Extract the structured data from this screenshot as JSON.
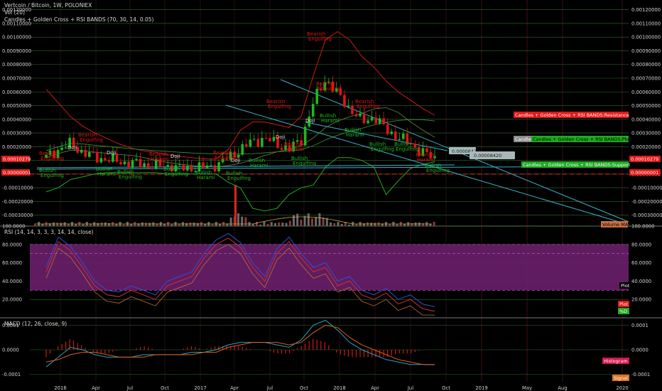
{
  "header": {
    "symbol": "Vertcoin / Bitcoin, 1W, POLONIEX",
    "volume": "Vol (20)",
    "indicator": "Candles + Golden Cross + RSI BANDS (70, 30, 14, 0.05)"
  },
  "rsi_panel": {
    "title": "RSI (14, 14, 3, 3, 3, 14, 14, close)"
  },
  "macd_panel": {
    "title": "MACD (12, 26, close, 9)"
  },
  "colors": {
    "background": "#000000",
    "grid": "#2f6b2f",
    "up": "#1fb81f",
    "down": "#e01515",
    "rsi_band": "#6a1f6a",
    "rsi_line": "#cc3030",
    "macd_line": "#26a3b8",
    "signal_line": "#e05a1a",
    "trendline": "#3ab0c8"
  },
  "chart_data": [
    {
      "type": "candlestick",
      "title": "Vertcoin / Bitcoin, 1W, POLONIEX",
      "x_ticks": [
        "2016",
        "Apr",
        "Jul",
        "Oct",
        "2017",
        "Apr",
        "Jul",
        "Oct",
        "2018",
        "Apr",
        "Jul",
        "Oct",
        "2019",
        "May",
        "Aug",
        "2020"
      ],
      "y_ticks_right": [
        "0.00120000",
        "0.00110000",
        "0.00100000",
        "0.00090000",
        "0.00080000",
        "0.00070000",
        "0.00060000",
        "0.00050000",
        "0.00040000",
        "0.00030000",
        "0.00020000",
        "0.00010000",
        "0.00000000",
        "-0.00010000",
        "-0.00020000",
        "-0.00030000"
      ],
      "y_ticks_left": [
        "0.00120000",
        "0.00110000",
        "0.00100000",
        "0.00090000",
        "0.00080000",
        "0.00070000",
        "0.00060000",
        "0.00050000",
        "0.00040000",
        "0.00030000",
        "0.00020000",
        "-0.00010000",
        "-0.00020000",
        "-0.00030000"
      ],
      "ylim": [
        -0.00038,
        0.00124
      ],
      "price_badges": [
        "0.00010279",
        "0.00000001"
      ],
      "price_label": "0.00010279",
      "zero_label": "0.00000001",
      "weeks": [
        "2016-01",
        "2016-02",
        "2016-03",
        "2016-04",
        "2016-05",
        "2016-06",
        "2016-07",
        "2016-08",
        "2016-09",
        "2016-10",
        "2016-11",
        "2016-12",
        "2017-01",
        "2017-02",
        "2017-03",
        "2017-04",
        "2017-05",
        "2017-06",
        "2017-07",
        "2017-08",
        "2017-09",
        "2017-10",
        "2017-11",
        "2017-12",
        "2018-01",
        "2018-02",
        "2018-03",
        "2018-04",
        "2018-05",
        "2018-06",
        "2018-07",
        "2018-08",
        "2018-09"
      ],
      "close": [
        0.00012,
        0.00018,
        0.00022,
        0.00016,
        0.00012,
        0.00011,
        9e-05,
        8e-05,
        7e-05,
        6e-05,
        6e-05,
        4e-05,
        4e-05,
        5e-05,
        6e-05,
        0.00012,
        0.00018,
        0.00024,
        0.00026,
        0.00022,
        0.00018,
        0.00025,
        0.00052,
        0.0007,
        0.00058,
        0.00048,
        0.00038,
        0.00042,
        0.00032,
        0.00027,
        0.00022,
        0.00016,
        0.00011
      ],
      "resistance": [
        0.00062,
        0.00052,
        0.00042,
        0.00035,
        0.0003,
        0.00026,
        0.00022,
        0.00019,
        0.00017,
        0.00016,
        0.00014,
        0.00013,
        0.00012,
        0.00011,
        0.00011,
        0.00018,
        0.00032,
        0.00038,
        0.00038,
        0.00036,
        0.00034,
        0.00042,
        0.00072,
        0.00098,
        0.00104,
        0.00098,
        0.00086,
        0.00078,
        0.00068,
        0.0006,
        0.00054,
        0.00048,
        0.00043
      ],
      "support": [
        -0.00013,
        -0.0001,
        -4e-05,
        -2e-05,
        0.0,
        1e-05,
        1e-05,
        1e-05,
        1e-05,
        1e-05,
        0.0,
        0.0,
        0.0,
        0.0,
        0.0,
        -6e-05,
        -0.0001,
        -0.00025,
        -0.00027,
        -0.00025,
        -0.00015,
        -0.0001,
        -8e-05,
        5e-05,
        0.00012,
        0.00012,
        0.0001,
        5e-05,
        -0.00015,
        -5e-05,
        4e-05,
        7e-05,
        9e-05
      ],
      "annotations": [
        "Bearish Engulfing",
        "Bullish Engulfing",
        "Bullish Harami",
        "Bearish Harami",
        "Doji"
      ],
      "legend_labels": [
        "Candles + Golden Cross + RSI BANDS:Resistance",
        "Candles + Golden Cross + RSI BANDS:Plot",
        "Candles + Golden Cross + RSI BANDS:Support"
      ],
      "callouts": [
        "0.00008420",
        "0.00008420"
      ],
      "volume_label": "Volume MA"
    },
    {
      "type": "line",
      "title": "RSI (14, 14, 3, 3, 3, 14, 14, close)",
      "y_ticks": [
        "100.0000",
        "80.0000",
        "60.0000",
        "40.0000",
        "20.0000"
      ],
      "y_ticks_right": [
        "100.0000",
        "80.0000",
        "60.0000",
        "40.0000",
        "20.0000"
      ],
      "ylim": [
        0,
        100
      ],
      "band": [
        30,
        80
      ],
      "series": [
        {
          "values": [
            55,
            88,
            78,
            60,
            40,
            30,
            28,
            35,
            30,
            25,
            40,
            45,
            50,
            70,
            85,
            92,
            82,
            60,
            45,
            75,
            88,
            70,
            55,
            60,
            40,
            45,
            30,
            25,
            32,
            20,
            25,
            15,
            12
          ]
        }
      ],
      "legend_labels": [
        "Plot",
        "Plot",
        "%D"
      ]
    },
    {
      "type": "line",
      "title": "MACD (12, 26, close, 9)",
      "y_ticks_left": [
        "0.0001",
        "0.0000",
        "-0.0001"
      ],
      "y_ticks_right": [
        "0.0001",
        "0.0000",
        "-0.0001"
      ],
      "ylim": [
        -0.00013,
        0.00013
      ],
      "series": [
        {
          "values": [
            -7e-05,
            -3e-05,
            1e-05,
            0.0,
            -2e-05,
            -3e-05,
            -3e-05,
            -3e-05,
            -2e-05,
            -2e-05,
            -2e-05,
            -2e-05,
            -1e-05,
            -1e-05,
            0.0,
            2e-05,
            3e-05,
            3e-05,
            3e-05,
            2e-05,
            1e-05,
            4e-05,
            0.0001,
            0.00012,
            8e-05,
            3e-05,
            0.0,
            -2e-05,
            -4e-05,
            -5e-05,
            -6e-05,
            -6e-05,
            -6e-05
          ]
        },
        {
          "values": [
            -5e-05,
            -4e-05,
            -2e-05,
            -1e-05,
            -1e-05,
            -2e-05,
            -3e-05,
            -3e-05,
            -3e-05,
            -2e-05,
            -2e-05,
            -2e-05,
            -2e-05,
            -1e-05,
            -1e-05,
            1e-05,
            2e-05,
            3e-05,
            3e-05,
            3e-05,
            2e-05,
            3e-05,
            7e-05,
            0.0001,
            9e-05,
            5e-05,
            2e-05,
            0.0,
            -2e-05,
            -4e-05,
            -5e-05,
            -6e-05,
            -6e-05
          ]
        }
      ],
      "legend_labels": [
        "Histogram",
        "Signal"
      ]
    }
  ]
}
